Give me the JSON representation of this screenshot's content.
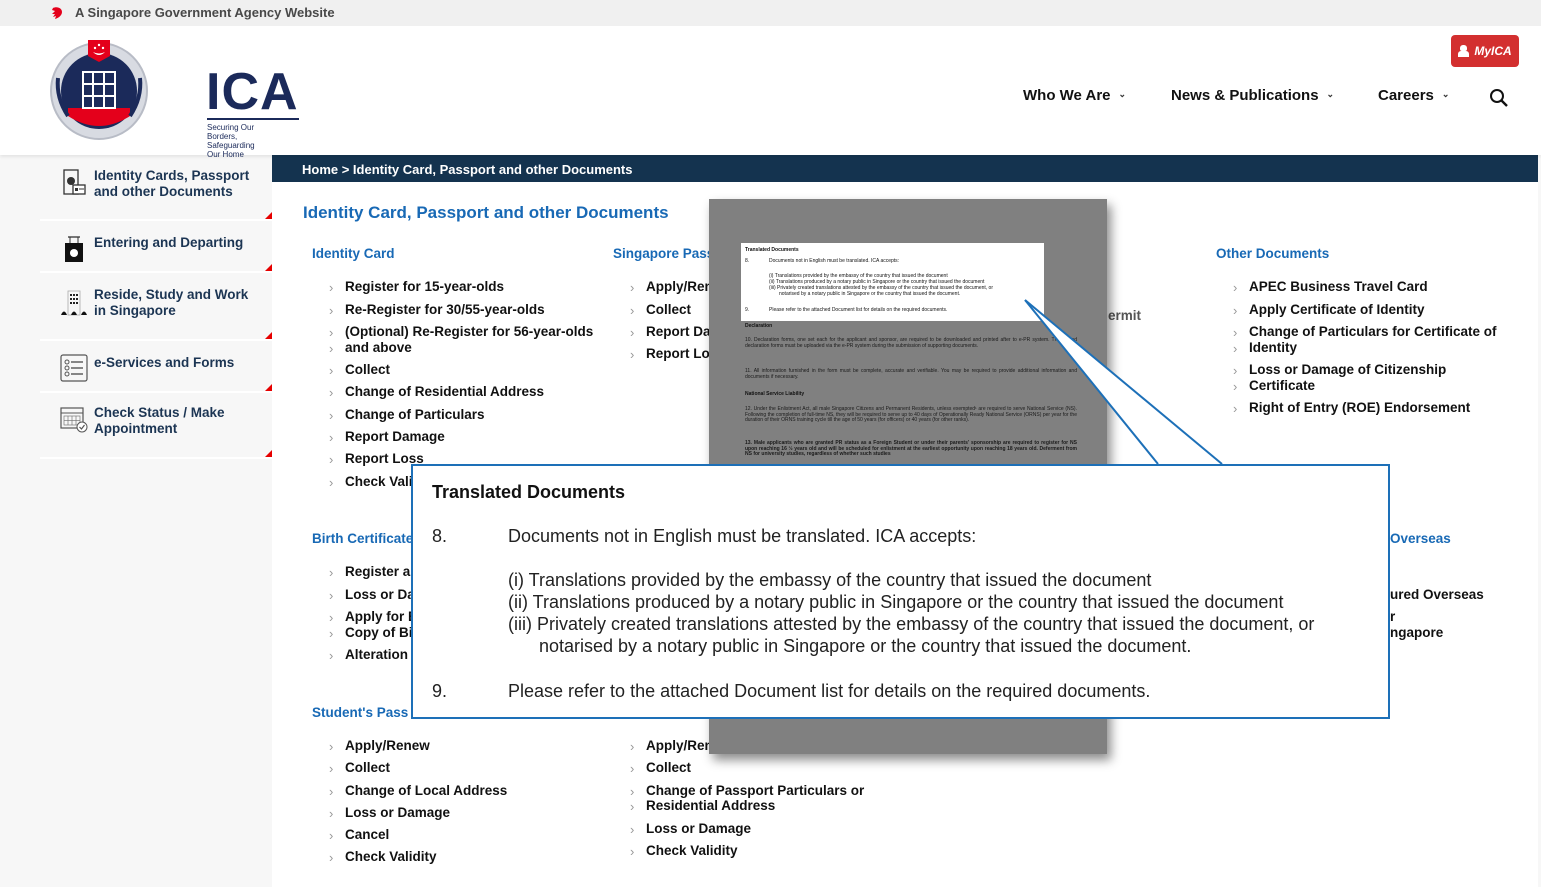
{
  "gov_banner": {
    "text": "A Singapore Government Agency Website",
    "icon": "lion-head-icon"
  },
  "header": {
    "logo": {
      "acronym": "ICA",
      "tagline_1": "Securing Our Borders,",
      "tagline_2": "Safeguarding Our Home"
    },
    "myica_label": "MyICA",
    "nav": [
      {
        "label": "Who We Are"
      },
      {
        "label": "News & Publications"
      },
      {
        "label": "Careers"
      }
    ],
    "chevron": "⌄"
  },
  "sidebar": {
    "items": [
      {
        "label": "Identity Cards, Passport and other Documents",
        "icon": "id-card-icon"
      },
      {
        "label": "Entering and Departing",
        "icon": "luggage-icon"
      },
      {
        "label": "Reside, Study and Work in Singapore",
        "icon": "building-icon"
      },
      {
        "label": "e-Services and Forms",
        "icon": "list-form-icon"
      },
      {
        "label": "Check Status / Make Appointment",
        "icon": "calendar-check-icon"
      }
    ]
  },
  "breadcrumb": {
    "text": "Home > Identity Card, Passport and other Documents"
  },
  "page_title": "Identity Card, Passport and other Documents",
  "categories": {
    "identity_card": {
      "title": "Identity Card",
      "links": [
        "Register for 15-year-olds",
        "Re-Register for 30/55-year-olds",
        "(Optional) Re-Register for 56-year-olds",
        "and above",
        "Collect",
        "Change of Residential Address",
        "Change of Particulars",
        "Report Damage",
        "Report Loss",
        "Check Vali"
      ]
    },
    "singapore_passport": {
      "title": "Singapore Pass",
      "links": [
        "Apply/Ren",
        "Collect",
        "Report Da",
        "Report Lo"
      ]
    },
    "permit_fragment": "ermit",
    "other_documents": {
      "title": "Other Documents",
      "links": [
        "APEC Business Travel Card",
        "Apply Certificate of Identity",
        "Change of Particulars for Certificate of",
        "Identity",
        "Loss or Damage of Citizenship",
        "Certificate",
        "Right of Entry (ROE) Endorsement"
      ]
    },
    "birth_certificate": {
      "title": "Birth Certificate",
      "links": [
        "Register ar",
        "Loss or Da",
        "Apply for B",
        "Copy of Bi",
        "Alteration"
      ]
    },
    "overseas": {
      "title": "Overseas",
      "links": [
        "ured Overseas",
        "r",
        "ngapore"
      ]
    },
    "students_pass": {
      "title": "Student's Pass",
      "links": [
        "Apply/Renew",
        "Collect",
        "Change of Local Address",
        "Loss or Damage",
        "Cancel",
        "Check Validity"
      ]
    },
    "other_pass": {
      "links": [
        "Apply/Ren",
        "Collect",
        "Change of Passport Particulars or",
        "Residential Address",
        "Loss or Damage",
        "Check Validity"
      ]
    }
  },
  "document": {
    "highlight": {
      "title": "Translated Documents",
      "p8_num": "8.",
      "p8": "Documents not in English must be translated. ICA accepts:",
      "i": "(i)  Translations provided by the embassy of the country that issued the document",
      "ii": "(ii) Translations produced by a notary public in Singapore or the country that issued the document",
      "iii_a": "(iii) Privately created translations attested by the embassy of the country that issued the document, or",
      "iii_b": "notarised by a notary public in Singapore or the country that issued the document.",
      "p9_num": "9.",
      "p9": "Please refer to the attached Document list for details on the required documents."
    },
    "declaration_title": "Declaration",
    "p10": "10.      Declaration forms, one set each for the applicant and sponsor, are required to be downloaded and printed after to e-PR system. The signed declaration forms must be uploaded via the e-PR system during the submission of supporting documents.",
    "p11": "11.      All information furnished in the form must be complete, accurate and verifiable. You may be required to provide additional information and documents if necessary.",
    "ns_title": "National Service Liability",
    "p12": "12.      Under the Enlistment Act, all male Singapore Citizens and Permanent Residents, unless exempted¹ are required to serve National Service (NS). Following the completion of full-time NS, they will be required to serve up to 40 days of Operationally Ready National Service (ORNS) per year for the duration of their ORNS training cycle till the age of 50 years (for officers) or 40 years (for other ranks).",
    "p13": "13.      Male applicants who are granted PR status as a Foreign Student or under their parents' sponsorship are required to register for NS upon reaching 16 ½ years old and will be scheduled for enlistment at the earliest opportunity upon reaching 18 years old. Deferment from NS for university studies, regardless of whether such studies"
  }
}
